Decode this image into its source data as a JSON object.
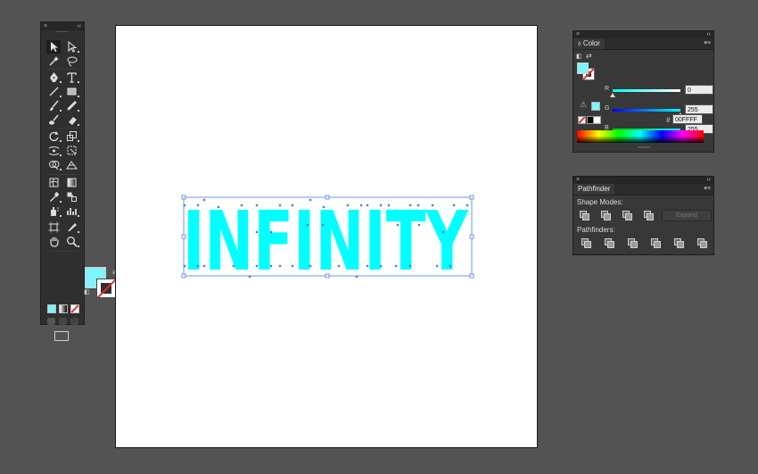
{
  "tools_panel": {
    "close_glyph": "×",
    "collapse_glyph": "‹‹",
    "tools": [
      [
        "selection-tool-icon",
        "direct-selection-tool-icon"
      ],
      [
        "magic-wand-tool-icon",
        "lasso-tool-icon"
      ],
      [
        "pen-tool-icon",
        "type-tool-icon"
      ],
      [
        "line-segment-tool-icon",
        "rectangle-tool-icon"
      ],
      [
        "paintbrush-tool-icon",
        "pencil-tool-icon"
      ],
      [
        "blob-brush-tool-icon",
        "eraser-tool-icon"
      ],
      [
        "rotate-tool-icon",
        "scale-tool-icon"
      ],
      [
        "width-tool-icon",
        "free-transform-tool-icon"
      ],
      [
        "shape-builder-tool-icon",
        "perspective-grid-tool-icon"
      ],
      [
        "mesh-tool-icon",
        "gradient-tool-icon"
      ],
      [
        "eyedropper-tool-icon",
        "blend-tool-icon"
      ],
      [
        "symbol-sprayer-tool-icon",
        "column-graph-tool-icon"
      ],
      [
        "artboard-tool-icon",
        "slice-tool-icon"
      ],
      [
        "hand-tool-icon",
        "zoom-tool-icon"
      ]
    ],
    "fill_color": "#7ff4ff",
    "stroke": "none"
  },
  "artwork": {
    "text": "INFINITY",
    "fill": "#00ffff",
    "selection_color": "#4a7fe0"
  },
  "color_panel": {
    "close_glyph": "×",
    "collapse_glyph": "‹‹",
    "tab_label": "Color",
    "menu_glyph": "▾≡",
    "channels": [
      {
        "label": "R",
        "value": "0",
        "level": 0
      },
      {
        "label": "G",
        "value": "255",
        "level": 1
      },
      {
        "label": "B",
        "value": "255",
        "level": 1
      }
    ],
    "hex_symbol": "#",
    "hex_value": "00FFFF"
  },
  "pathfinder_panel": {
    "close_glyph": "×",
    "collapse_glyph": "‹‹",
    "tab_label": "Pathfinder",
    "menu_glyph": "▾≡",
    "shape_modes_label": "Shape Modes:",
    "expand_label": "Expand",
    "pathfinders_label": "Pathfinders:"
  }
}
